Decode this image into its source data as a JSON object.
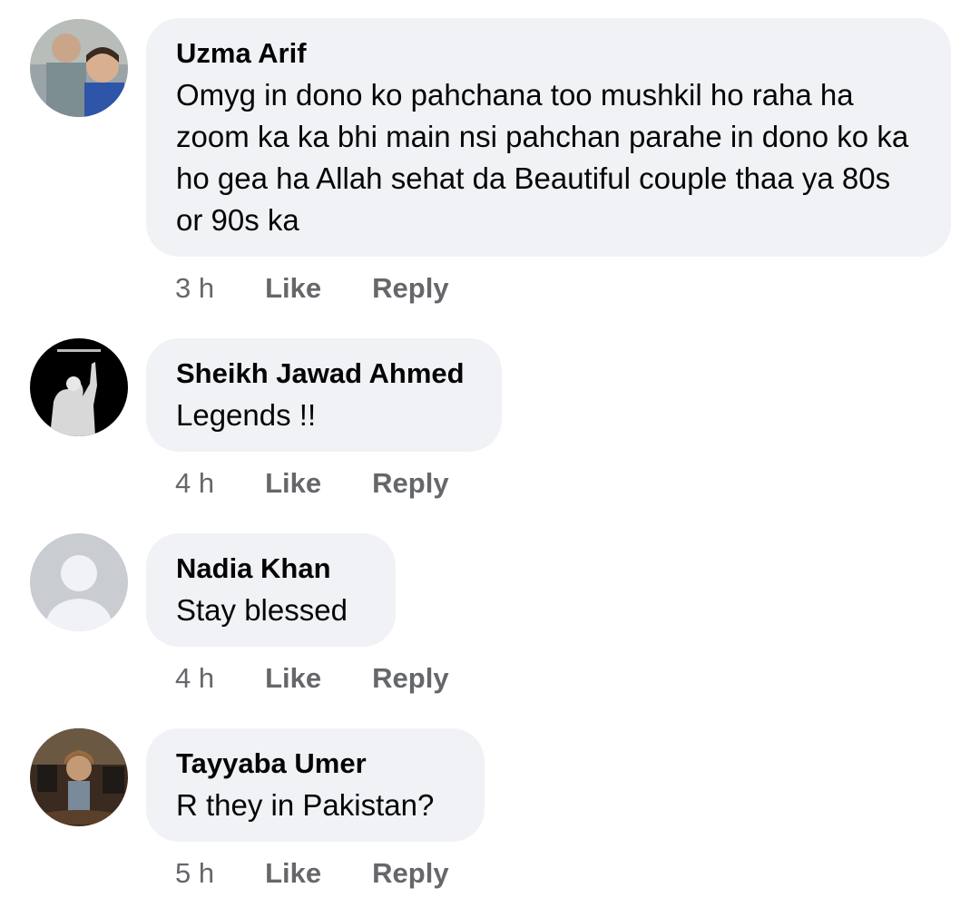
{
  "comments": [
    {
      "author": "Uzma Arif",
      "text": "Omyg in dono ko pahchana too mushkil ho raha ha zoom ka ka bhi main nsi pahchan parahe in dono ko ka ho gea ha Allah sehat da Beautiful couple thaa ya 80s or 90s ka",
      "time": "3 h",
      "like": "Like",
      "reply": "Reply"
    },
    {
      "author": "Sheikh Jawad Ahmed",
      "text": "Legends !!",
      "time": "4 h",
      "like": "Like",
      "reply": "Reply"
    },
    {
      "author": "Nadia Khan",
      "text": "Stay blessed",
      "time": "4 h",
      "like": "Like",
      "reply": "Reply"
    },
    {
      "author": "Tayyaba Umer",
      "text": "R they in Pakistan?",
      "time": "5 h",
      "like": "Like",
      "reply": "Reply"
    }
  ],
  "colors": {
    "bubble": "#f0f2f5",
    "text": "#050505",
    "secondary": "#65676b"
  }
}
